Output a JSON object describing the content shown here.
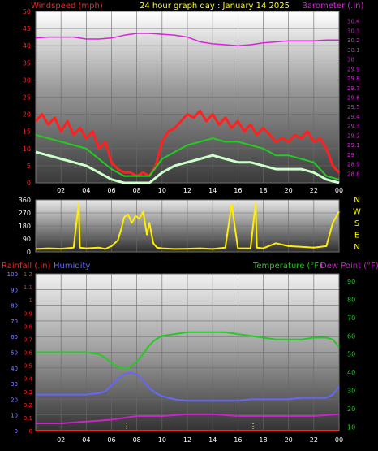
{
  "header": {
    "windspeed_label": "Windspeed (mph)",
    "title": "24 hour graph day : January 14 2025",
    "barometer_label": "Barometer (.in)"
  },
  "colors": {
    "wind": "#ff2020",
    "wind_avg": "#22cc22",
    "wind_light": "#ccffcc",
    "barometer": "#dd22dd",
    "direction": "#ffee00",
    "humidity": "#6666ff",
    "temperature": "#22cc22",
    "dewpoint": "#cc22cc",
    "rainfall": "#ff2020",
    "axis_text": "#ff2020",
    "header_yellow": "#ffff00"
  },
  "chart_data": [
    {
      "type": "line",
      "name": "wind-barometer",
      "x_ticks": [
        "02",
        "04",
        "06",
        "08",
        "10",
        "12",
        "14",
        "16",
        "18",
        "20",
        "22",
        "00"
      ],
      "y_left_ticks": [
        0,
        5,
        10,
        15,
        20,
        25,
        30,
        35,
        40,
        45,
        50
      ],
      "y_left_range": [
        0,
        50
      ],
      "y_right_ticks": [
        "28.8",
        "28.9",
        "29",
        "29.1",
        "29.2",
        "29.3",
        "29.4",
        "29.5",
        "29.6",
        "29.7",
        "29.8",
        "29.9",
        "30",
        "30.1",
        "30.2",
        "30.3",
        "30.4"
      ],
      "y_right_range": [
        28.7,
        30.5
      ],
      "x_range_hours": [
        0,
        24
      ],
      "series": [
        {
          "name": "Windspeed (mph)",
          "axis": "left",
          "x": [
            0,
            0.5,
            1,
            1.5,
            2,
            2.5,
            3,
            3.5,
            4,
            4.5,
            5,
            5.5,
            6,
            6.5,
            7,
            7.5,
            8,
            8.5,
            9,
            9.5,
            10,
            10.5,
            11,
            11.5,
            12,
            12.5,
            13,
            13.5,
            14,
            14.5,
            15,
            15.5,
            16,
            16.5,
            17,
            17.5,
            18,
            18.5,
            19,
            19.5,
            20,
            20.5,
            21,
            21.5,
            22,
            22.5,
            23,
            23.5,
            24
          ],
          "y": [
            18,
            20,
            17,
            19,
            15,
            18,
            14,
            16,
            13,
            15,
            10,
            12,
            6,
            4,
            3,
            3,
            2,
            3,
            2,
            5,
            12,
            15,
            16,
            18,
            20,
            19,
            21,
            18,
            20,
            17,
            19,
            16,
            18,
            15,
            17,
            14,
            16,
            14,
            12,
            13,
            12,
            14,
            13,
            15,
            12,
            13,
            10,
            5,
            3
          ]
        },
        {
          "name": "Wind average (mph)",
          "axis": "left",
          "x": [
            0,
            1,
            2,
            3,
            4,
            5,
            6,
            7,
            8,
            9,
            10,
            11,
            12,
            13,
            14,
            15,
            16,
            17,
            18,
            19,
            20,
            21,
            22,
            23,
            24
          ],
          "y": [
            14,
            13,
            12,
            11,
            10,
            7,
            4,
            2,
            2,
            2,
            7,
            9,
            11,
            12,
            13,
            12,
            12,
            11,
            10,
            8,
            8,
            7,
            6,
            2,
            1
          ]
        },
        {
          "name": "Wind gust low (mph)",
          "axis": "left",
          "x": [
            0,
            1,
            2,
            3,
            4,
            5,
            6,
            7,
            8,
            9,
            10,
            11,
            12,
            13,
            14,
            15,
            16,
            17,
            18,
            19,
            20,
            21,
            22,
            23,
            24
          ],
          "y": [
            9,
            8,
            7,
            6,
            5,
            3,
            1,
            0,
            0,
            0,
            3,
            5,
            6,
            7,
            8,
            7,
            6,
            6,
            5,
            4,
            4,
            4,
            3,
            1,
            0
          ]
        },
        {
          "name": "Barometer (.in)",
          "axis": "right",
          "x": [
            0,
            1,
            2,
            3,
            4,
            5,
            6,
            7,
            8,
            9,
            10,
            11,
            12,
            13,
            14,
            15,
            16,
            17,
            18,
            19,
            20,
            21,
            22,
            23,
            24
          ],
          "y": [
            30.22,
            30.23,
            30.23,
            30.23,
            30.21,
            30.21,
            30.22,
            30.25,
            30.27,
            30.27,
            30.26,
            30.25,
            30.23,
            30.18,
            30.16,
            30.15,
            30.14,
            30.15,
            30.17,
            30.18,
            30.19,
            30.19,
            30.19,
            30.2,
            30.2
          ]
        }
      ]
    },
    {
      "type": "scatter",
      "name": "wind-direction",
      "y_left_ticks": [
        0,
        90,
        180,
        270,
        360
      ],
      "y_range": [
        0,
        360
      ],
      "compass_labels": [
        "N",
        "W",
        "S",
        "E",
        "N"
      ],
      "x_range_hours": [
        0,
        24
      ],
      "series": [
        {
          "name": "Wind direction (deg)",
          "x": [
            0,
            1,
            2,
            3,
            3.4,
            3.5,
            4,
            5,
            5.5,
            6,
            6.5,
            6.8,
            7,
            7.3,
            7.6,
            7.9,
            8.2,
            8.5,
            8.8,
            9,
            9.3,
            9.6,
            10,
            11,
            12,
            13,
            14,
            15,
            15.5,
            16,
            17,
            17.4,
            17.5,
            18,
            19,
            20,
            21,
            22,
            23,
            23.5,
            24
          ],
          "y": [
            20,
            25,
            22,
            30,
            340,
            30,
            25,
            30,
            20,
            40,
            80,
            170,
            240,
            260,
            200,
            250,
            230,
            280,
            120,
            200,
            60,
            30,
            25,
            20,
            22,
            25,
            20,
            30,
            330,
            25,
            25,
            340,
            30,
            25,
            60,
            40,
            35,
            30,
            40,
            200,
            280
          ]
        }
      ]
    },
    {
      "type": "line",
      "name": "rain-humidity-temperature",
      "header_left_1": "Rainfall (.in)",
      "header_left_2": "Humidity",
      "header_right_1": "Temperature (°F)",
      "header_right_2": "Dew Point (°F)",
      "y_rain_ticks": [
        "0",
        "0.1",
        "0.2",
        "0.3",
        "0.4",
        "0.5",
        "0.6",
        "0.7",
        "0.8",
        "0.9",
        "1",
        "1.1",
        "1.2"
      ],
      "y_rain_range": [
        0,
        1.2
      ],
      "y_humidity_ticks": [
        0,
        10,
        20,
        30,
        40,
        50,
        60,
        70,
        80,
        90,
        100
      ],
      "y_humidity_range": [
        0,
        100
      ],
      "y_temp_ticks": [
        10,
        20,
        30,
        40,
        50,
        60,
        70,
        80,
        90
      ],
      "y_temp_range": [
        8,
        94
      ],
      "x_ticks": [
        "02",
        "04",
        "06",
        "08",
        "10",
        "12",
        "14",
        "16",
        "18",
        "20",
        "22",
        "00"
      ],
      "x_range_hours": [
        0,
        24
      ],
      "series": [
        {
          "name": "Temperature (°F)",
          "axis": "temp",
          "x": [
            0,
            1,
            2,
            3,
            4,
            5,
            5.5,
            6,
            6.5,
            7,
            7.5,
            8,
            8.5,
            9,
            9.5,
            10,
            11,
            12,
            13,
            14,
            15,
            16,
            17,
            18,
            19,
            20,
            21,
            22,
            23,
            23.5,
            24
          ],
          "y": [
            51,
            51,
            51,
            51,
            51,
            50,
            48,
            45,
            43,
            42,
            43,
            46,
            50,
            55,
            58,
            60,
            61,
            62,
            62,
            62,
            62,
            61,
            60,
            59,
            58,
            58,
            58,
            59,
            59,
            58,
            54
          ]
        },
        {
          "name": "Humidity",
          "axis": "humidity",
          "x": [
            0,
            1,
            2,
            3,
            4,
            5,
            5.5,
            6,
            6.5,
            7,
            7.5,
            8,
            8.5,
            9,
            9.5,
            10,
            11,
            12,
            13,
            14,
            15,
            16,
            17,
            18,
            19,
            20,
            21,
            22,
            23,
            23.5,
            24
          ],
          "y": [
            23,
            23,
            23,
            23,
            23,
            24,
            25,
            29,
            33,
            36,
            37,
            36,
            32,
            27,
            24,
            22,
            20,
            19,
            19,
            19,
            19,
            19,
            20,
            20,
            20,
            20,
            21,
            21,
            21,
            23,
            28
          ]
        },
        {
          "name": "Dew Point (°F)",
          "axis": "temp",
          "x": [
            0,
            2,
            4,
            6,
            7,
            8,
            9,
            10,
            12,
            14,
            16,
            18,
            20,
            22,
            24
          ],
          "y": [
            12,
            12,
            13,
            14,
            15,
            16,
            16,
            16,
            17,
            17,
            16,
            16,
            16,
            16,
            17
          ]
        },
        {
          "name": "Rainfall (.in)",
          "axis": "rain",
          "x": [
            0,
            24
          ],
          "y": [
            0,
            0
          ]
        }
      ],
      "markers_hours": [
        7.2,
        17.2
      ]
    }
  ]
}
